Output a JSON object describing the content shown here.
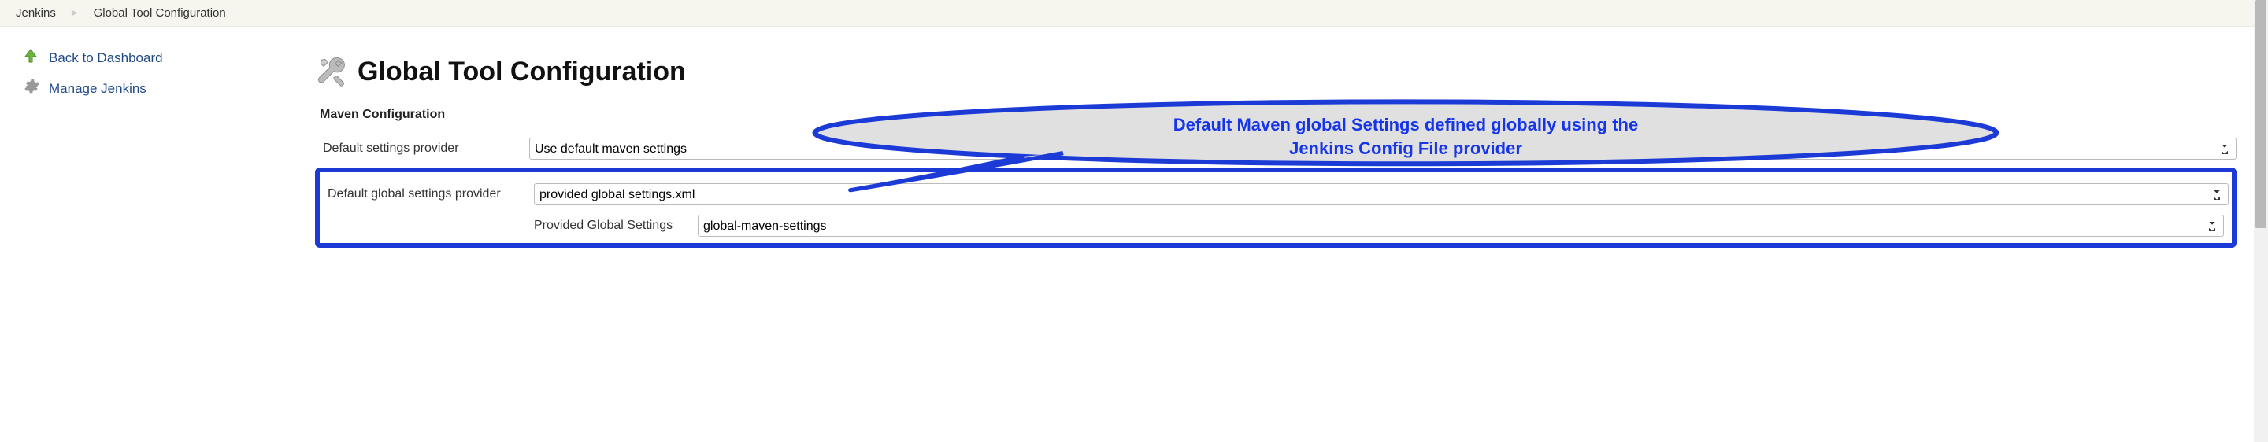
{
  "breadcrumb": {
    "root": "Jenkins",
    "current": "Global Tool Configuration"
  },
  "sidebar": {
    "back_label": "Back to Dashboard",
    "manage_label": "Manage Jenkins"
  },
  "page": {
    "title": "Global Tool Configuration"
  },
  "maven": {
    "section_title": "Maven Configuration",
    "default_settings_label": "Default settings provider",
    "default_settings_value": "Use default maven settings",
    "default_global_label": "Default global settings provider",
    "default_global_value": "provided global settings.xml",
    "provided_global_label": "Provided Global Settings",
    "provided_global_value": "global-maven-settings"
  },
  "annotation": {
    "line1": "Default Maven global Settings defined globally using the",
    "line2": "Jenkins Config File provider"
  }
}
